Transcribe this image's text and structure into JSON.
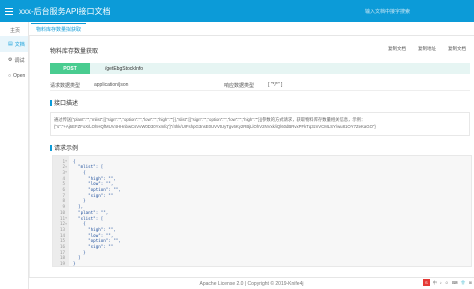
{
  "header": {
    "title": "xxx-后台服务API接口文档",
    "search_placeholder": "输入文档中接字搜索"
  },
  "sidebar": {
    "items": [
      {
        "icon": "doc",
        "label": "文档"
      },
      {
        "icon": "globe",
        "label": "调试"
      },
      {
        "icon": "open",
        "label": "Open"
      }
    ]
  },
  "tabs": {
    "home": "主页",
    "active": "物料库存数量拟获取"
  },
  "api": {
    "title": "物料库存数量获取",
    "actions": [
      "复制文档",
      "复制地址",
      "复制文档"
    ],
    "method": "POST",
    "path": "/getEbgStockInfo",
    "request_type_label": "请求数据类型",
    "request_type": "application/json",
    "response_type_label": "响应数据类型",
    "response_type": "[ \"*/*\" ]"
  },
  "desc": {
    "heading": "接口描述",
    "text": "通过传送{\"plant\":\"\",\"mlist\":[{\"sign\":\"\",\"option\":\"\",\"low\":\"\",\"high\":\"\"}],\"slist\":[{\"sign\":\"\",\"option\":\"\",\"low\":\"\",\"high\":\"\"}]}参数的方式请求，获取物料库存数量相关信息，示例：{\"s\":\"+Aj6EFZFoX/LOhHQfMUV4HHnbwCsVvW0D30Yxmfq\"}\"/4hk/UIFshpG3nsE0UVVtUyTgv6Ky2RBjLlOhV2NVxk/iQl60dBRvxPFkTq3znVCMLSY/wu81OY7ZeKaGO\"}"
  },
  "example": {
    "heading": "请求示例",
    "lines": [
      {
        "n": "1",
        "fold": "▾",
        "text": "{"
      },
      {
        "n": "2",
        "fold": "▾",
        "text": "  \"mlist\": ["
      },
      {
        "n": "3",
        "fold": "▾",
        "text": "    {"
      },
      {
        "n": "4",
        "fold": "",
        "text": "      \"high\": \"\","
      },
      {
        "n": "5",
        "fold": "",
        "text": "      \"low\": \"\","
      },
      {
        "n": "6",
        "fold": "",
        "text": "      \"option\": \"\","
      },
      {
        "n": "7",
        "fold": "",
        "text": "      \"sign\": \"\""
      },
      {
        "n": "8",
        "fold": "",
        "text": "    }"
      },
      {
        "n": "9",
        "fold": "",
        "text": "  ],"
      },
      {
        "n": "10",
        "fold": "",
        "text": "  \"plant\": \"\","
      },
      {
        "n": "11",
        "fold": "▾",
        "text": "  \"slist\": ["
      },
      {
        "n": "12",
        "fold": "▾",
        "text": "    {"
      },
      {
        "n": "13",
        "fold": "",
        "text": "      \"high\": \"\","
      },
      {
        "n": "14",
        "fold": "",
        "text": "      \"low\": \"\","
      },
      {
        "n": "15",
        "fold": "",
        "text": "      \"option\": \"\","
      },
      {
        "n": "16",
        "fold": "",
        "text": "      \"sign\": \"\""
      },
      {
        "n": "17",
        "fold": "",
        "text": "    }"
      },
      {
        "n": "18",
        "fold": "",
        "text": "  ]"
      },
      {
        "n": "19",
        "fold": "",
        "text": "}"
      }
    ]
  },
  "footer": {
    "text": "Apache License 2.0 | Copyright © 2019-Knife4j"
  },
  "tray": {
    "badge": "S",
    "items": [
      "中",
      "♪",
      "☺",
      "⌨",
      "👕",
      "⊞"
    ]
  },
  "colors": {
    "header": "#0c9bd8",
    "post": "#49cc90",
    "post_row": "#e6f5f3"
  }
}
